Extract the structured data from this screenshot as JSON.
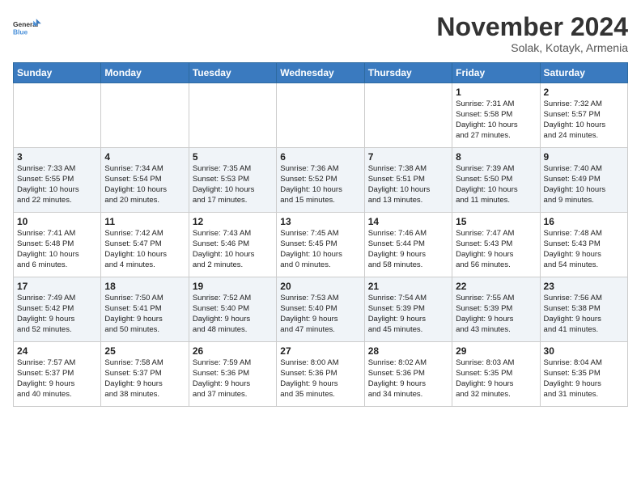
{
  "header": {
    "logo_line1": "General",
    "logo_line2": "Blue",
    "month": "November 2024",
    "location": "Solak, Kotayk, Armenia"
  },
  "weekdays": [
    "Sunday",
    "Monday",
    "Tuesday",
    "Wednesday",
    "Thursday",
    "Friday",
    "Saturday"
  ],
  "weeks": [
    [
      {
        "day": "",
        "info": ""
      },
      {
        "day": "",
        "info": ""
      },
      {
        "day": "",
        "info": ""
      },
      {
        "day": "",
        "info": ""
      },
      {
        "day": "",
        "info": ""
      },
      {
        "day": "1",
        "info": "Sunrise: 7:31 AM\nSunset: 5:58 PM\nDaylight: 10 hours\nand 27 minutes."
      },
      {
        "day": "2",
        "info": "Sunrise: 7:32 AM\nSunset: 5:57 PM\nDaylight: 10 hours\nand 24 minutes."
      }
    ],
    [
      {
        "day": "3",
        "info": "Sunrise: 7:33 AM\nSunset: 5:55 PM\nDaylight: 10 hours\nand 22 minutes."
      },
      {
        "day": "4",
        "info": "Sunrise: 7:34 AM\nSunset: 5:54 PM\nDaylight: 10 hours\nand 20 minutes."
      },
      {
        "day": "5",
        "info": "Sunrise: 7:35 AM\nSunset: 5:53 PM\nDaylight: 10 hours\nand 17 minutes."
      },
      {
        "day": "6",
        "info": "Sunrise: 7:36 AM\nSunset: 5:52 PM\nDaylight: 10 hours\nand 15 minutes."
      },
      {
        "day": "7",
        "info": "Sunrise: 7:38 AM\nSunset: 5:51 PM\nDaylight: 10 hours\nand 13 minutes."
      },
      {
        "day": "8",
        "info": "Sunrise: 7:39 AM\nSunset: 5:50 PM\nDaylight: 10 hours\nand 11 minutes."
      },
      {
        "day": "9",
        "info": "Sunrise: 7:40 AM\nSunset: 5:49 PM\nDaylight: 10 hours\nand 9 minutes."
      }
    ],
    [
      {
        "day": "10",
        "info": "Sunrise: 7:41 AM\nSunset: 5:48 PM\nDaylight: 10 hours\nand 6 minutes."
      },
      {
        "day": "11",
        "info": "Sunrise: 7:42 AM\nSunset: 5:47 PM\nDaylight: 10 hours\nand 4 minutes."
      },
      {
        "day": "12",
        "info": "Sunrise: 7:43 AM\nSunset: 5:46 PM\nDaylight: 10 hours\nand 2 minutes."
      },
      {
        "day": "13",
        "info": "Sunrise: 7:45 AM\nSunset: 5:45 PM\nDaylight: 10 hours\nand 0 minutes."
      },
      {
        "day": "14",
        "info": "Sunrise: 7:46 AM\nSunset: 5:44 PM\nDaylight: 9 hours\nand 58 minutes."
      },
      {
        "day": "15",
        "info": "Sunrise: 7:47 AM\nSunset: 5:43 PM\nDaylight: 9 hours\nand 56 minutes."
      },
      {
        "day": "16",
        "info": "Sunrise: 7:48 AM\nSunset: 5:43 PM\nDaylight: 9 hours\nand 54 minutes."
      }
    ],
    [
      {
        "day": "17",
        "info": "Sunrise: 7:49 AM\nSunset: 5:42 PM\nDaylight: 9 hours\nand 52 minutes."
      },
      {
        "day": "18",
        "info": "Sunrise: 7:50 AM\nSunset: 5:41 PM\nDaylight: 9 hours\nand 50 minutes."
      },
      {
        "day": "19",
        "info": "Sunrise: 7:52 AM\nSunset: 5:40 PM\nDaylight: 9 hours\nand 48 minutes."
      },
      {
        "day": "20",
        "info": "Sunrise: 7:53 AM\nSunset: 5:40 PM\nDaylight: 9 hours\nand 47 minutes."
      },
      {
        "day": "21",
        "info": "Sunrise: 7:54 AM\nSunset: 5:39 PM\nDaylight: 9 hours\nand 45 minutes."
      },
      {
        "day": "22",
        "info": "Sunrise: 7:55 AM\nSunset: 5:39 PM\nDaylight: 9 hours\nand 43 minutes."
      },
      {
        "day": "23",
        "info": "Sunrise: 7:56 AM\nSunset: 5:38 PM\nDaylight: 9 hours\nand 41 minutes."
      }
    ],
    [
      {
        "day": "24",
        "info": "Sunrise: 7:57 AM\nSunset: 5:37 PM\nDaylight: 9 hours\nand 40 minutes."
      },
      {
        "day": "25",
        "info": "Sunrise: 7:58 AM\nSunset: 5:37 PM\nDaylight: 9 hours\nand 38 minutes."
      },
      {
        "day": "26",
        "info": "Sunrise: 7:59 AM\nSunset: 5:36 PM\nDaylight: 9 hours\nand 37 minutes."
      },
      {
        "day": "27",
        "info": "Sunrise: 8:00 AM\nSunset: 5:36 PM\nDaylight: 9 hours\nand 35 minutes."
      },
      {
        "day": "28",
        "info": "Sunrise: 8:02 AM\nSunset: 5:36 PM\nDaylight: 9 hours\nand 34 minutes."
      },
      {
        "day": "29",
        "info": "Sunrise: 8:03 AM\nSunset: 5:35 PM\nDaylight: 9 hours\nand 32 minutes."
      },
      {
        "day": "30",
        "info": "Sunrise: 8:04 AM\nSunset: 5:35 PM\nDaylight: 9 hours\nand 31 minutes."
      }
    ]
  ]
}
